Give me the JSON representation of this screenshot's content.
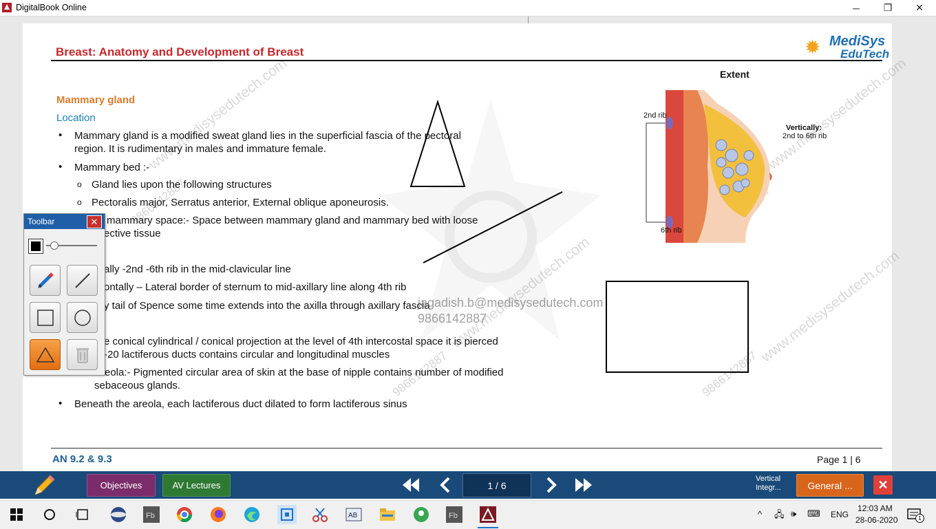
{
  "window": {
    "title": "DigitalBook Online",
    "minimize": "─",
    "maximize": "❐",
    "close": "✕"
  },
  "document": {
    "title": "Breast: Anatomy and Development of Breast",
    "logo_line1": "MediSys",
    "logo_line2": "EduTech",
    "heading_gland": "Mammary gland",
    "heading_location": "Location",
    "bullet_char": "•",
    "sub_bullet_char": "o",
    "line_1a": "Mammary gland is a modified sweat gland lies in the superficial fascia of the pectoral",
    "line_1b": "region. It is rudimentary in males and immature female.",
    "line_2": "Mammary bed :-",
    "line_2a": "Gland lies upon the following structures",
    "line_2b": "Pectoralis major, Serratus anterior, External oblique aponeurosis.",
    "line_3a": "mammary space:- Space between mammary gland and mammary bed with loose",
    "line_3b": "ective tissue",
    "line_4": "ally -2nd -6th rib in the mid-clavicular line",
    "line_5": "ontally – Lateral border of sternum to mid-axillary line along 4th rib",
    "line_6": "y tail of Spence some time extends into the axilla through axillary fascia",
    "line_7a": "e conical cylindrical / conical projection at the level of 4th intercostal space it is pierced",
    "line_7b": "-20 lactiferous ducts contains circular and longitudinal muscles",
    "line_8a": "Areola:- Pigmented circular area of skin at the base of nipple contains number of modified",
    "line_8b": "sebaceous glands.",
    "line_9": "Beneath the areola, each lactiferous duct dilated to form lactiferous sinus",
    "extent_label": "Extent",
    "rib2_label": "2nd rib",
    "rib6_label": "6th rib",
    "vertical_label": "Vertically:",
    "vertical_value": "2nd to 6th rib",
    "footer_left": "AN 9.2 & 9.3",
    "footer_right": "Page 1 | 6",
    "watermark_email": "jagadish.b@medisysedutech.com",
    "watermark_phone": "9866142887",
    "watermark_site": "www.medisysedutech.com"
  },
  "toolbar": {
    "title": "Toolbar",
    "close": "✕",
    "selected_color": "#000000",
    "tools": [
      "pen-tool",
      "line-tool",
      "rectangle-tool",
      "circle-tool",
      "triangle-tool",
      "trash-tool"
    ],
    "active_tool": "triangle-tool"
  },
  "bottombar": {
    "objectives": "Objectives",
    "av_lectures": "AV Lectures",
    "page_indicator": "1 / 6",
    "vertical_line1": "Vertical",
    "vertical_line2": "Integr...",
    "general": "General ...",
    "close": "✕"
  },
  "taskbar": {
    "lang": "ENG",
    "time": "12:03 AM",
    "date": "28-06-2020",
    "notifications": "1"
  }
}
